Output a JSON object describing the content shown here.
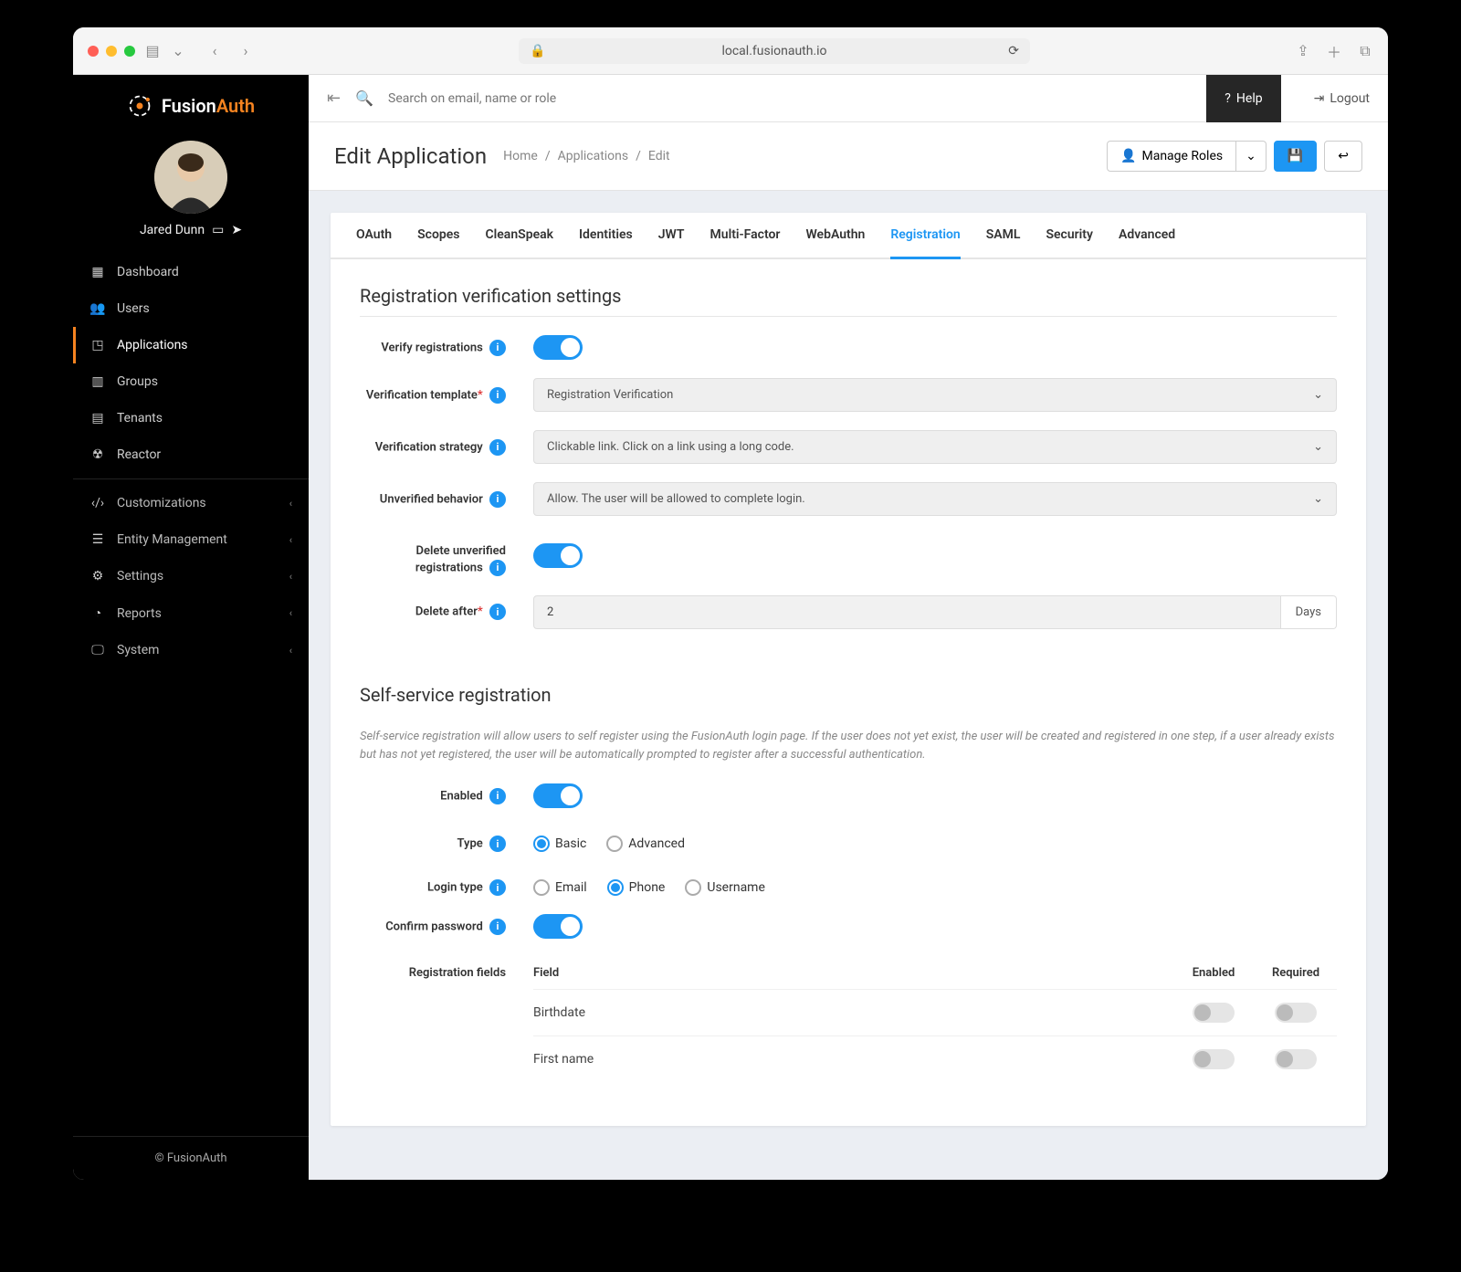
{
  "browser": {
    "url": "local.fusionauth.io"
  },
  "logo": {
    "brand_a": "Fusion",
    "brand_b": "Auth"
  },
  "user": {
    "name": "Jared Dunn"
  },
  "sidebar": {
    "items": [
      {
        "label": "Dashboard"
      },
      {
        "label": "Users"
      },
      {
        "label": "Applications"
      },
      {
        "label": "Groups"
      },
      {
        "label": "Tenants"
      },
      {
        "label": "Reactor"
      },
      {
        "label": "Customizations"
      },
      {
        "label": "Entity Management"
      },
      {
        "label": "Settings"
      },
      {
        "label": "Reports"
      },
      {
        "label": "System"
      }
    ],
    "footer": "© FusionAuth"
  },
  "topbar": {
    "search_placeholder": "Search on email, name or role",
    "help": "Help",
    "logout": "Logout"
  },
  "header": {
    "title": "Edit Application",
    "crumbs": [
      "Home",
      "Applications",
      "Edit"
    ],
    "manage_roles": "Manage Roles"
  },
  "tabs": [
    "OAuth",
    "Scopes",
    "CleanSpeak",
    "Identities",
    "JWT",
    "Multi-Factor",
    "WebAuthn",
    "Registration",
    "SAML",
    "Security",
    "Advanced"
  ],
  "active_tab": "Registration",
  "section1": {
    "title": "Registration verification settings",
    "verify_label": "Verify registrations",
    "template_label": "Verification template",
    "template_value": "Registration Verification",
    "strategy_label": "Verification strategy",
    "strategy_value": "Clickable link. Click on a link using a long code.",
    "unverified_label": "Unverified behavior",
    "unverified_value": "Allow. The user will be allowed to complete login.",
    "delete_label": "Delete unverified registrations",
    "delete_after_label": "Delete after",
    "delete_after_value": "2",
    "delete_after_unit": "Days"
  },
  "section2": {
    "title": "Self-service registration",
    "help": "Self-service registration will allow users to self register using the FusionAuth login page. If the user does not yet exist, the user will be created and registered in one step, if a user already exists but has not yet registered, the user will be automatically prompted to register after a successful authentication.",
    "enabled_label": "Enabled",
    "type_label": "Type",
    "type_options": [
      "Basic",
      "Advanced"
    ],
    "type_selected": "Basic",
    "login_type_label": "Login type",
    "login_type_options": [
      "Email",
      "Phone",
      "Username"
    ],
    "login_type_selected": "Phone",
    "confirm_label": "Confirm password",
    "reg_fields_label": "Registration fields",
    "table_headers": [
      "Field",
      "Enabled",
      "Required"
    ],
    "fields": [
      "Birthdate",
      "First name"
    ]
  }
}
